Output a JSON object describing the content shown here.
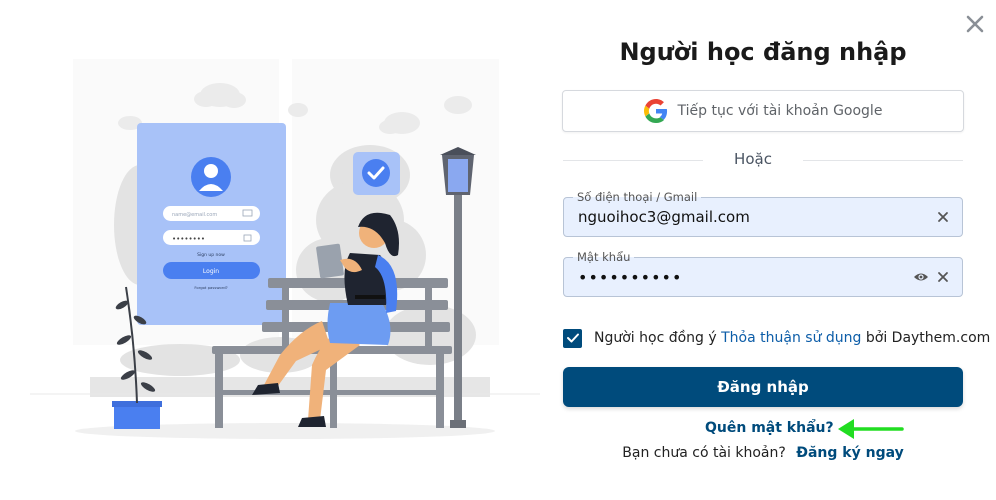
{
  "modal": {
    "title": "Người học đăng nhập",
    "google_button": "Tiếp tục với tài khoản Google",
    "divider_text": "Hoặc",
    "phone_email": {
      "label": "Số điện thoại / Gmail",
      "value": "nguoihoc3@gmail.com"
    },
    "password": {
      "label": "Mật khẩu",
      "value": "••••••••••"
    },
    "agree": {
      "prefix": "Người học đồng ý",
      "link": "Thỏa thuận sử dụng",
      "suffix": "bởi Daythem.com",
      "checked": true
    },
    "login_button": "Đăng nhập",
    "forgot_password": "Quên mật khẩu?",
    "no_account_text": "Bạn chưa có tài khoản?",
    "signup_link": "Đăng ký ngay"
  },
  "illustration": {
    "email_placeholder": "name@email.com",
    "password_dots": "••••••••",
    "sign_up": "Sign up now",
    "login": "Login",
    "forgot": "Forgot password?"
  },
  "colors": {
    "primary": "#004b7c",
    "field_bg": "#e8f0fe",
    "accent_blue": "#4a7ff0",
    "card_blue": "#a8c2f8",
    "arrow_green": "#22dd22"
  },
  "icons": {
    "close": "close-icon",
    "google": "google-logo-icon",
    "clear": "clear-icon",
    "eye": "eye-icon",
    "check": "check-icon",
    "arrow": "arrow-left-icon"
  }
}
